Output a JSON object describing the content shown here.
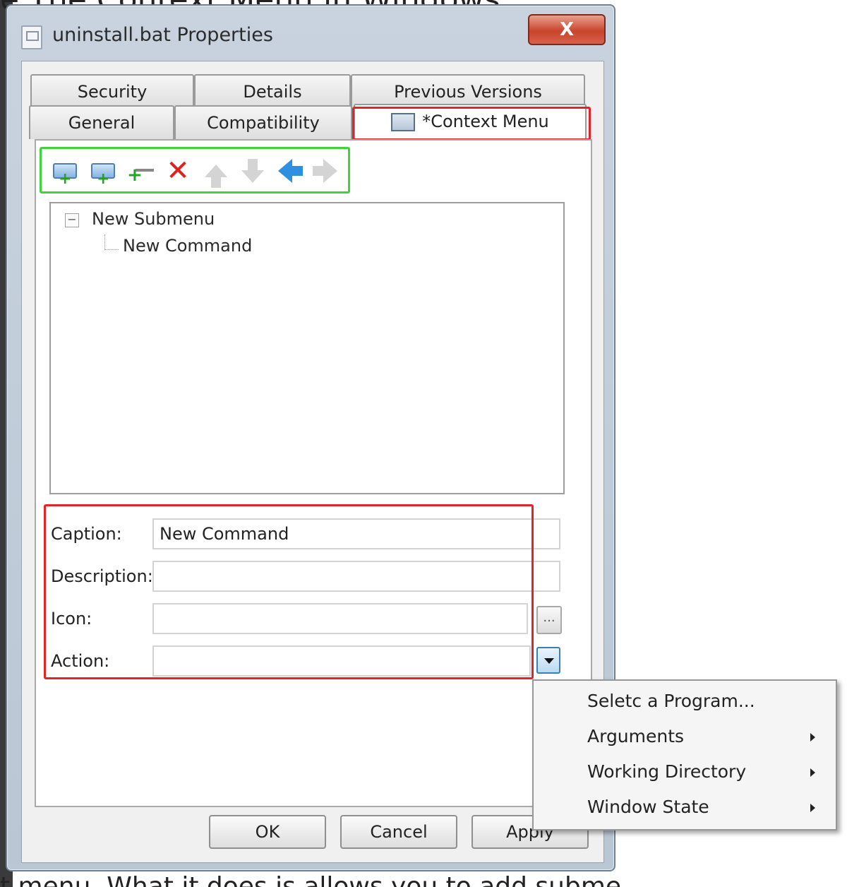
{
  "window": {
    "title": "uninstall.bat Properties",
    "close_label": "X"
  },
  "tabs": {
    "row1": [
      "Security",
      "Details",
      "Previous Versions"
    ],
    "row2": [
      "General",
      "Compatibility",
      "*Context Menu"
    ],
    "active": "*Context Menu"
  },
  "toolbar": {
    "buttons": [
      "add-submenu-icon",
      "add-command-icon",
      "add-separator-icon",
      "delete-icon",
      "move-up-icon",
      "move-down-icon",
      "move-left-icon",
      "move-right-icon"
    ]
  },
  "tree": {
    "nodes": [
      {
        "label": "New Submenu",
        "expander": "−"
      },
      {
        "label": "New Command"
      }
    ]
  },
  "form": {
    "caption_label": "Caption:",
    "caption_value": "New Command",
    "description_label": "Description:",
    "description_value": "",
    "icon_label": "Icon:",
    "icon_value": "",
    "browse_label": "...",
    "action_label": "Action:",
    "action_value": ""
  },
  "buttons": {
    "ok": "OK",
    "cancel": "Cancel",
    "apply": "Apply"
  },
  "context_menu": {
    "items": [
      {
        "label": "Seletc a Program...",
        "submenu": false
      },
      {
        "label": "Arguments",
        "submenu": true
      },
      {
        "label": "Working Directory",
        "submenu": true
      },
      {
        "label": "Window State",
        "submenu": true
      }
    ]
  },
  "background": {
    "top_text": "e The Context Menu in Windows",
    "bottom_text": "t menu. What it does is allows you to add submenu to th"
  },
  "colors": {
    "highlight_red": "#e0242c",
    "highlight_green": "#3fd33a",
    "close_button": "#c9442c"
  }
}
